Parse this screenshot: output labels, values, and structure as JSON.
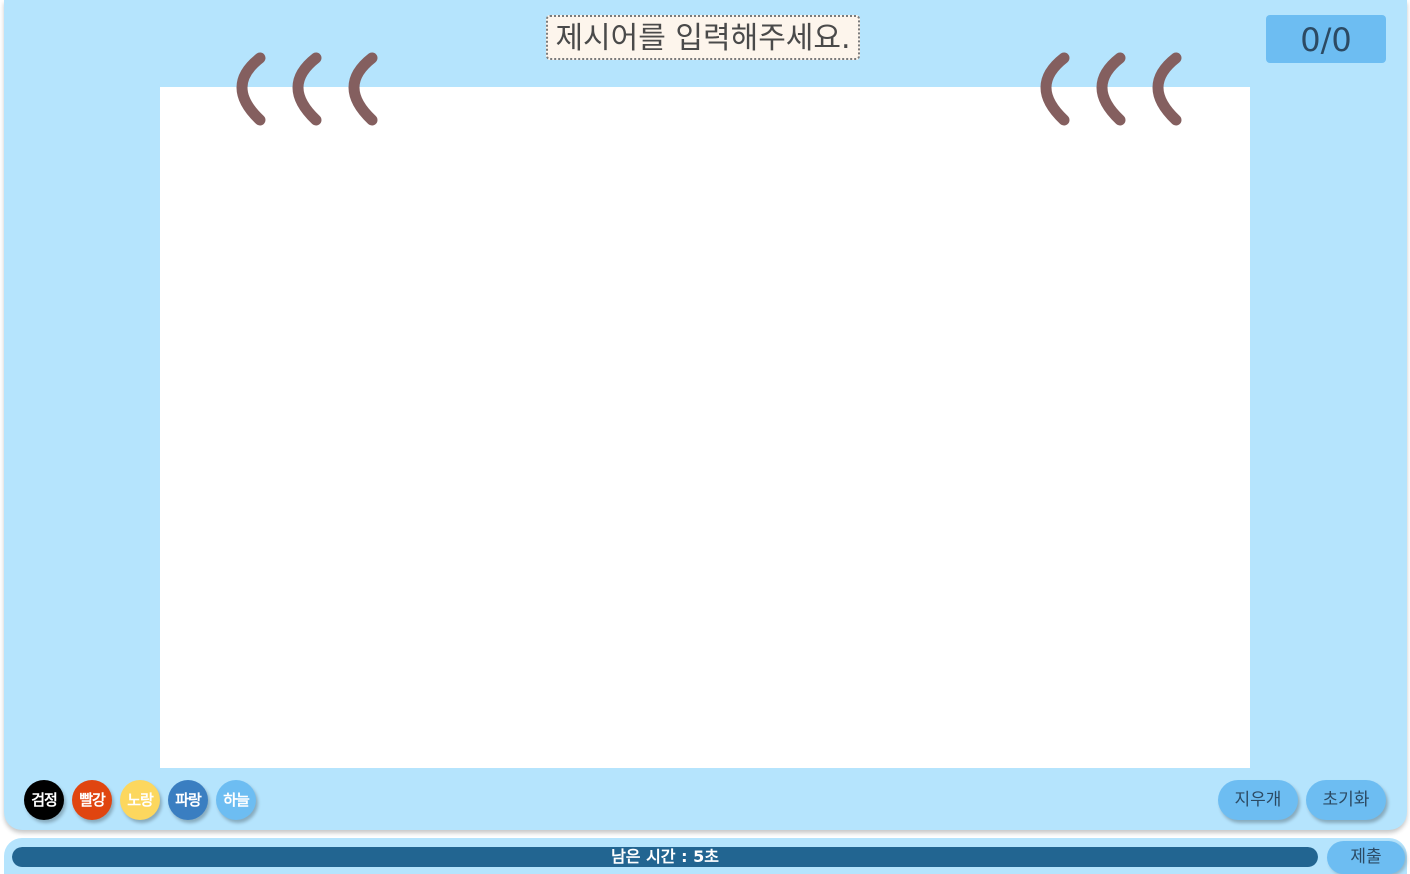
{
  "prompt": {
    "text": "제시어를 입력해주세요."
  },
  "score": {
    "text": "0/0"
  },
  "colors": {
    "hook": "#845f5f",
    "panel": "#b5e4fd",
    "accent": "#6dbdf2",
    "timer_fill": "#226591"
  },
  "palette": [
    {
      "label": "검정",
      "color": "#000000"
    },
    {
      "label": "빨강",
      "color": "#e04510"
    },
    {
      "label": "노랑",
      "color": "#fcd75e"
    },
    {
      "label": "파랑",
      "color": "#3a7ec1"
    },
    {
      "label": "하늘",
      "color": "#6dbdf2"
    }
  ],
  "tools": {
    "eraser_label": "지우개",
    "reset_label": "초기화"
  },
  "timer": {
    "text": "남은 시간 : 5초",
    "progress": 1.0
  },
  "submit": {
    "label": "제출"
  }
}
